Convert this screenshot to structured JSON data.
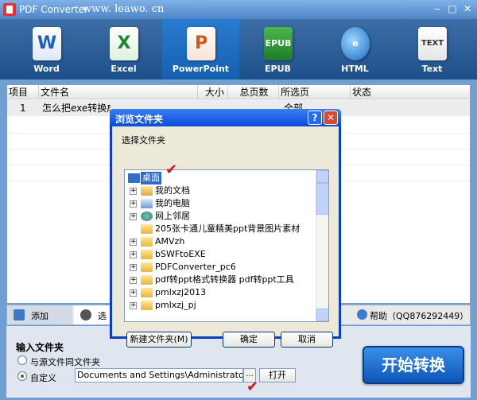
{
  "app": {
    "title": "PDF Converter",
    "url": "www. leawo. cn",
    "min": "‒",
    "max": "□",
    "close": "✕"
  },
  "toolbar": {
    "items": [
      {
        "label": "Word",
        "icon": "W"
      },
      {
        "label": "Excel",
        "icon": "X"
      },
      {
        "label": "PowerPoint",
        "icon": "P"
      },
      {
        "label": "EPUB",
        "icon": "EPUB"
      },
      {
        "label": "HTML",
        "icon": "e"
      },
      {
        "label": "Text",
        "icon": "TEXT"
      }
    ]
  },
  "list": {
    "headers": [
      "项目",
      "文件名",
      "大小",
      "总页数",
      "所选页",
      "状态"
    ],
    "row": {
      "index": "1",
      "filename": "怎么把exe转换成",
      "size": "",
      "pages": "",
      "selected": "全部",
      "status": ""
    }
  },
  "tabs": {
    "add": "添加",
    "options": "选",
    "help": "帮助（QQ876292449）"
  },
  "output": {
    "title": "输入文件夹",
    "same_folder": "与源文件同文件夹",
    "custom": "自定义",
    "path": "Documents and Settings\\Administrator\\桌面\\",
    "browse": "...",
    "open": "打开",
    "start": "开始转换"
  },
  "dialog": {
    "title": "浏览文件夹",
    "help": "?",
    "close": "✕",
    "prompt": "选择文件夹",
    "tree": [
      "桌面",
      "我的文档",
      "我的电脑",
      "网上邻居",
      "205张卡通儿童精美ppt背景图片素材",
      "AMVzh",
      "bSWFtoEXE",
      "PDFConverter_pc6",
      "pdf转ppt格式转换器 pdf转ppt工具",
      "pmlxzj2013",
      "pmlxzj_pj"
    ],
    "new_folder": "新建文件夹(M)",
    "ok": "确定",
    "cancel": "取消"
  },
  "annotations": {
    "check": "✔"
  }
}
